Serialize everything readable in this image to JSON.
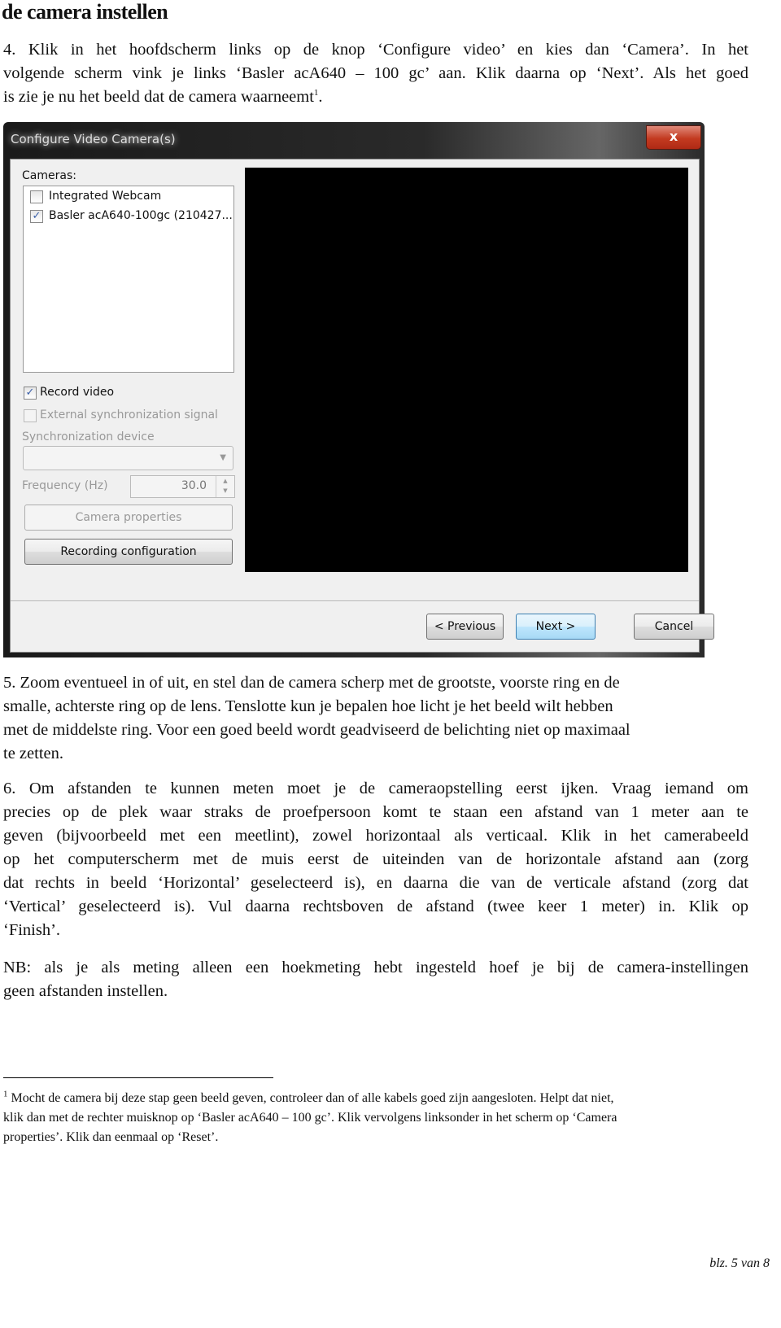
{
  "heading": "de camera instellen",
  "step4": {
    "lines": [
      "4. Klik in het hoofdscherm links op de knop ‘Configure video’ en kies dan ‘Camera’. In het",
      "volgende scherm vink je links ‘Basler acA640 – 100 gc’ aan. Klik daarna op ‘Next’. Als het goed",
      "is zie je nu het beeld dat de camera waarneemt"
    ],
    "footnote_ref": "1"
  },
  "dialog": {
    "title": "Configure Video Camera(s)",
    "close_icon": "x",
    "cameras_label": "Cameras:",
    "cameras": [
      {
        "label": "Integrated Webcam",
        "checked": false
      },
      {
        "label": "Basler acA640-100gc (210427...",
        "checked": true
      }
    ],
    "record_video": {
      "label": "Record video",
      "checked": true
    },
    "external_sync": {
      "label": "External synchronization signal",
      "checked": false
    },
    "sync_device_label": "Synchronization device",
    "sync_device_value": "",
    "frequency_label": "Frequency (Hz)",
    "frequency_value": "30.0",
    "camera_properties": "Camera properties",
    "recording_configuration": "Recording configuration",
    "previous": "< Previous",
    "next": "Next >",
    "cancel": "Cancel"
  },
  "step5": {
    "lines": [
      "5. Zoom eventueel in of uit, en stel dan de camera scherp met de grootste, voorste ring en de",
      "smalle, achterste ring op de lens. Tenslotte kun je bepalen hoe licht je het beeld wilt hebben",
      "met de middelste ring. Voor een goed beeld wordt geadviseerd de belichting niet op maximaal",
      "te zetten."
    ]
  },
  "step6": {
    "lines": [
      "6. Om afstanden te kunnen meten moet je de cameraopstelling eerst ijken. Vraag iemand om",
      "precies op de plek waar straks de proefpersoon komt te staan een afstand van 1 meter aan te",
      "geven (bijvoorbeeld met een meetlint), zowel horizontaal als verticaal. Klik in het camerabeeld",
      "op het computerscherm met de muis eerst de uiteinden van de horizontale afstand aan (zorg",
      "dat rechts in beeld ‘Horizontal’ geselecteerd is), en daarna die van de verticale afstand (zorg dat",
      "‘Vertical’ geselecteerd is). Vul daarna rechtsboven de afstand (twee keer 1 meter) in. Klik op",
      "‘Finish’."
    ]
  },
  "nb": {
    "lines": [
      "NB: als je als meting alleen een hoekmeting hebt ingesteld hoef je bij de camera-instellingen",
      "geen afstanden instellen."
    ]
  },
  "footnote": {
    "mark": "1",
    "lines": [
      "Mocht de camera bij deze stap geen beeld geven, controleer dan of alle kabels goed zijn aangesloten. Helpt dat niet,",
      "klik dan met de rechter muisknop op ‘Basler acA640 – 100 gc’. Klik vervolgens linksonder in het scherm op ‘Camera",
      "properties’. Klik dan eenmaal op ‘Reset’."
    ]
  },
  "page_number": "blz. 5 van 8"
}
